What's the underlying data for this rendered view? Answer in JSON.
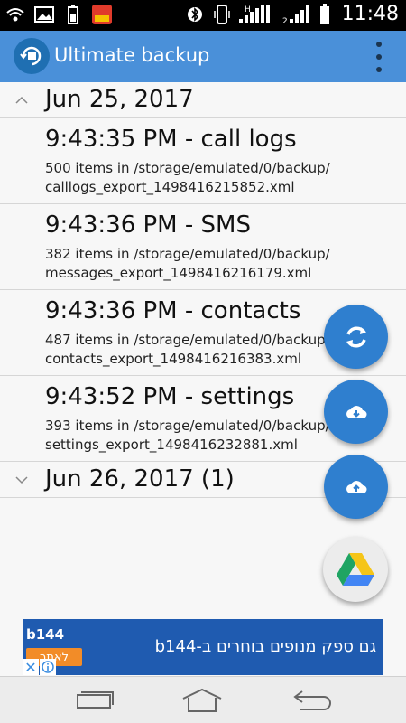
{
  "status_bar": {
    "time": "11:48",
    "left_icons": [
      "wifi-signal-icon",
      "image-icon",
      "battery-icon",
      "itube-app-icon"
    ],
    "right_icons": [
      "bluetooth-icon",
      "phone-vibrate-icon",
      "signal-h-icon",
      "signal-2-icon",
      "battery-icon"
    ],
    "h_label": "H",
    "sim2_label": "2"
  },
  "app_bar": {
    "title": "Ultimate backup",
    "logo_icon": "backup-logo-icon",
    "menu_icon": "overflow-menu-icon"
  },
  "groups": [
    {
      "date": "Jun 25, 2017",
      "expanded": true,
      "items": [
        {
          "title": "9:43:35 PM - call logs",
          "line1": "500 items in /storage/emulated/0/backup/",
          "line2": "calllogs_export_1498416215852.xml"
        },
        {
          "title": "9:43:36 PM - SMS",
          "line1": "382 items in /storage/emulated/0/backup/",
          "line2": "messages_export_1498416216179.xml"
        },
        {
          "title": "9:43:36 PM - contacts",
          "line1": "487 items in /storage/emulated/0/backup/",
          "line2": "contacts_export_1498416216383.xml"
        },
        {
          "title": "9:43:52 PM - settings",
          "line1": "393 items in /storage/emulated/0/backup/",
          "line2": "settings_export_1498416232881.xml"
        }
      ]
    },
    {
      "date": "Jun 26, 2017 (1)",
      "expanded": false,
      "items": []
    }
  ],
  "fabs": {
    "sync_icon": "sync-icon",
    "download_icon": "cloud-download-icon",
    "upload_icon": "cloud-upload-icon",
    "drive_icon": "google-drive-icon"
  },
  "ad": {
    "brand": "b144",
    "cta": "לאתר",
    "text": "גם ספק מנופים בוחרים ב-b144",
    "close_icon": "close-icon",
    "info_icon": "info-icon"
  },
  "nav_bar": {
    "recents_icon": "recents-icon",
    "home_icon": "home-icon",
    "back_icon": "back-icon"
  },
  "colors": {
    "app_bar": "#4a90d9",
    "fab": "#2f7fcf",
    "ad_bg": "#1f5bb0",
    "ad_cta": "#f28c28"
  }
}
